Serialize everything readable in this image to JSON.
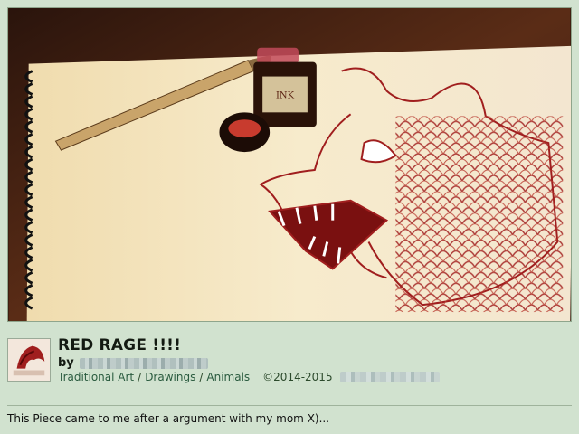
{
  "deviation": {
    "title": "RED RAGE !!!!",
    "by_label": "by",
    "categories": [
      "Traditional Art",
      "Drawings",
      "Animals"
    ],
    "category_separator": "/",
    "copyright": "©2014-2015",
    "description": "This Piece came to me after a argument with my mom X)...",
    "ink_label": "INK"
  },
  "colors": {
    "background": "#d1e2cf",
    "ink_red": "#a01e1e",
    "paper": "#f5e8c4"
  },
  "icons": {
    "artwork": "wolf-drawing-image",
    "avatar": "artist-avatar-image"
  }
}
